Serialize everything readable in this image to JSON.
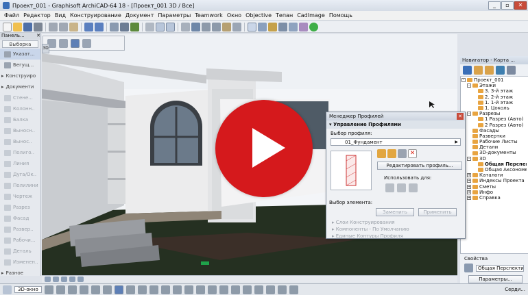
{
  "window": {
    "title": "Проект_001 - Graphisoft ArchiCAD-64 18 - [Проект_001 3D / Все]",
    "controls": [
      "_",
      "▫",
      "✕"
    ]
  },
  "menu": [
    "Файл",
    "Редактор",
    "Вид",
    "Конструирование",
    "Документ",
    "Параметры",
    "Teamwork",
    "Окно",
    "Objective",
    "Тепан",
    "CadImage",
    "Помощь"
  ],
  "toolbox": {
    "header": "Панель...",
    "close": "✕",
    "tab": "Выборка",
    "items": [
      {
        "label": "Указат...",
        "state": "sel"
      },
      {
        "label": "Бегущ...",
        "state": "normal"
      },
      {
        "label": "Конструиро",
        "state": "group"
      },
      {
        "label": "Документи",
        "state": "group"
      },
      {
        "label": "Стене...",
        "state": "dim"
      },
      {
        "label": "Колонн..",
        "state": "dim"
      },
      {
        "label": "Балка",
        "state": "dim"
      },
      {
        "label": "Выносн..",
        "state": "dim"
      },
      {
        "label": "Вынос..",
        "state": "dim"
      },
      {
        "label": "Полиго..",
        "state": "dim"
      },
      {
        "label": "Линия",
        "state": "dim"
      },
      {
        "label": "Дуга/Ок..",
        "state": "dim"
      },
      {
        "label": "Полилини",
        "state": "dim"
      },
      {
        "label": "Чертеж",
        "state": "dim"
      },
      {
        "label": "Разрез",
        "state": "dim"
      },
      {
        "label": "Фасад",
        "state": "dim"
      },
      {
        "label": "Развер..",
        "state": "dim"
      },
      {
        "label": "Рабочи...",
        "state": "dim"
      },
      {
        "label": "Деталь",
        "state": "dim"
      },
      {
        "label": "Изменен..",
        "state": "dim"
      },
      {
        "label": "Разное",
        "state": "group"
      }
    ]
  },
  "viewport": {
    "side_tab": "3D"
  },
  "navigator": {
    "title": "Навигатор - Карта ...",
    "tree": [
      {
        "level": 0,
        "label": "Проект_001",
        "box": "-"
      },
      {
        "level": 1,
        "label": "Этажи",
        "box": "-"
      },
      {
        "level": 2,
        "label": "3. 3-й этаж",
        "box": ""
      },
      {
        "level": 2,
        "label": "2. 2-й этаж",
        "box": ""
      },
      {
        "level": 2,
        "label": "1. 1-й этаж",
        "box": ""
      },
      {
        "level": 2,
        "label": "1. Цоколь",
        "box": ""
      },
      {
        "level": 1,
        "label": "Разрезы",
        "box": "-"
      },
      {
        "level": 2,
        "label": "1 Разрез (Авто)",
        "box": ""
      },
      {
        "level": 2,
        "label": "2 Разрез (Авто)",
        "box": ""
      },
      {
        "level": 1,
        "label": "Фасады",
        "box": ""
      },
      {
        "level": 1,
        "label": "Развертки",
        "box": ""
      },
      {
        "level": 1,
        "label": "Рабочие Листы",
        "box": ""
      },
      {
        "level": 1,
        "label": "Детали",
        "box": ""
      },
      {
        "level": 1,
        "label": "3D-документы",
        "box": ""
      },
      {
        "level": 1,
        "label": "3D",
        "box": "-"
      },
      {
        "level": 2,
        "label": "Общая Перспектива",
        "box": "",
        "bold": true
      },
      {
        "level": 2,
        "label": "Общая Аксонометрия",
        "box": ""
      },
      {
        "level": 1,
        "label": "Каталоги",
        "box": "+"
      },
      {
        "level": 1,
        "label": "Индексы Проекта",
        "box": "+"
      },
      {
        "level": 1,
        "label": "Сметы",
        "box": "+"
      },
      {
        "level": 1,
        "label": "Инфо",
        "box": "+"
      },
      {
        "level": 1,
        "label": "Справка",
        "box": "+"
      }
    ],
    "props_label": "Свойства",
    "props_value": "Общая Перспектива",
    "params_button": "Параметры..."
  },
  "dialog": {
    "title": "Менеджер Профилей",
    "section": "Управление Профилями",
    "profile_label": "Выбор профиля:",
    "profile_value": "01_Фундамент",
    "edit_button": "Редактировать профиль...",
    "use_for_label": "Использовать для:",
    "element_label": "Выбор элемента:",
    "replace_button": "Заменить",
    "apply_button": "Применить",
    "collapsed": [
      "Слои Конструирования",
      "Компоненты - По Умолчанию",
      "Единые Контуры Профиля"
    ]
  },
  "statusbar": {
    "view_name": "3D-окно",
    "right_label": "Серди..."
  },
  "colors": {
    "play_button": "#d5191c",
    "sky": "#f3f5f8",
    "grass": "#253021"
  }
}
